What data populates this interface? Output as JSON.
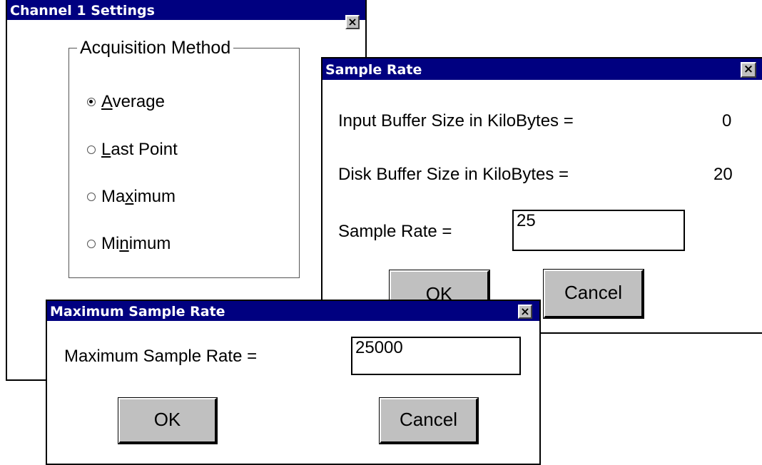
{
  "channel_window": {
    "title": "Channel 1 Settings",
    "close_glyph": "×",
    "group_title": "Acquisition Method",
    "options": [
      {
        "pre": "",
        "accel": "A",
        "post": "verage",
        "selected": true
      },
      {
        "pre": "",
        "accel": "L",
        "post": "ast Point",
        "selected": false
      },
      {
        "pre": "Ma",
        "accel": "x",
        "post": "imum",
        "selected": false
      },
      {
        "pre": "Mi",
        "accel": "n",
        "post": "imum",
        "selected": false
      }
    ]
  },
  "sample_rate_window": {
    "title": "Sample Rate",
    "close_glyph": "×",
    "input_buffer_label": "Input Buffer Size in KiloBytes =",
    "input_buffer_value": "0",
    "disk_buffer_label": "Disk Buffer Size in KiloBytes =",
    "disk_buffer_value": "20",
    "sample_rate_label": "Sample Rate =",
    "sample_rate_value": "25",
    "ok_label": "OK",
    "cancel_label": "Cancel"
  },
  "max_rate_window": {
    "title": "Maximum Sample Rate",
    "close_glyph": "×",
    "field_label": "Maximum Sample Rate =",
    "field_value": "25000",
    "ok_label": "OK",
    "cancel_label": "Cancel"
  },
  "colors": {
    "titlebar": "#000080",
    "button_face": "#c0c0c0"
  }
}
